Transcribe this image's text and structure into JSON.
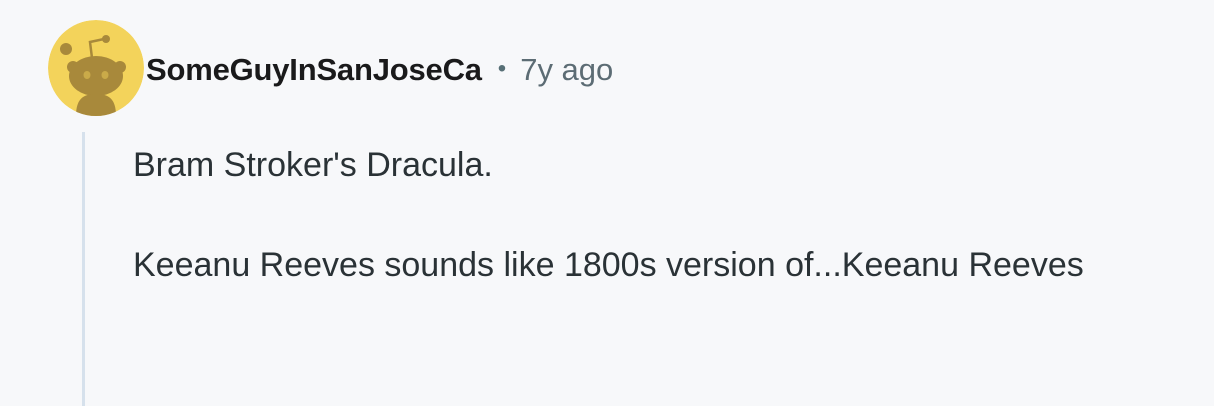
{
  "comment": {
    "author": "SomeGuyInSanJoseCa",
    "separator": "•",
    "time_ago": "7y ago",
    "avatar_icon": "snoo-avatar-icon",
    "avatar_bg_color": "#f3d35b",
    "paragraphs": [
      "Bram Stroker's Dracula.",
      "Keeanu Reeves sounds like 1800s version of...Keeanu Reeves"
    ]
  }
}
